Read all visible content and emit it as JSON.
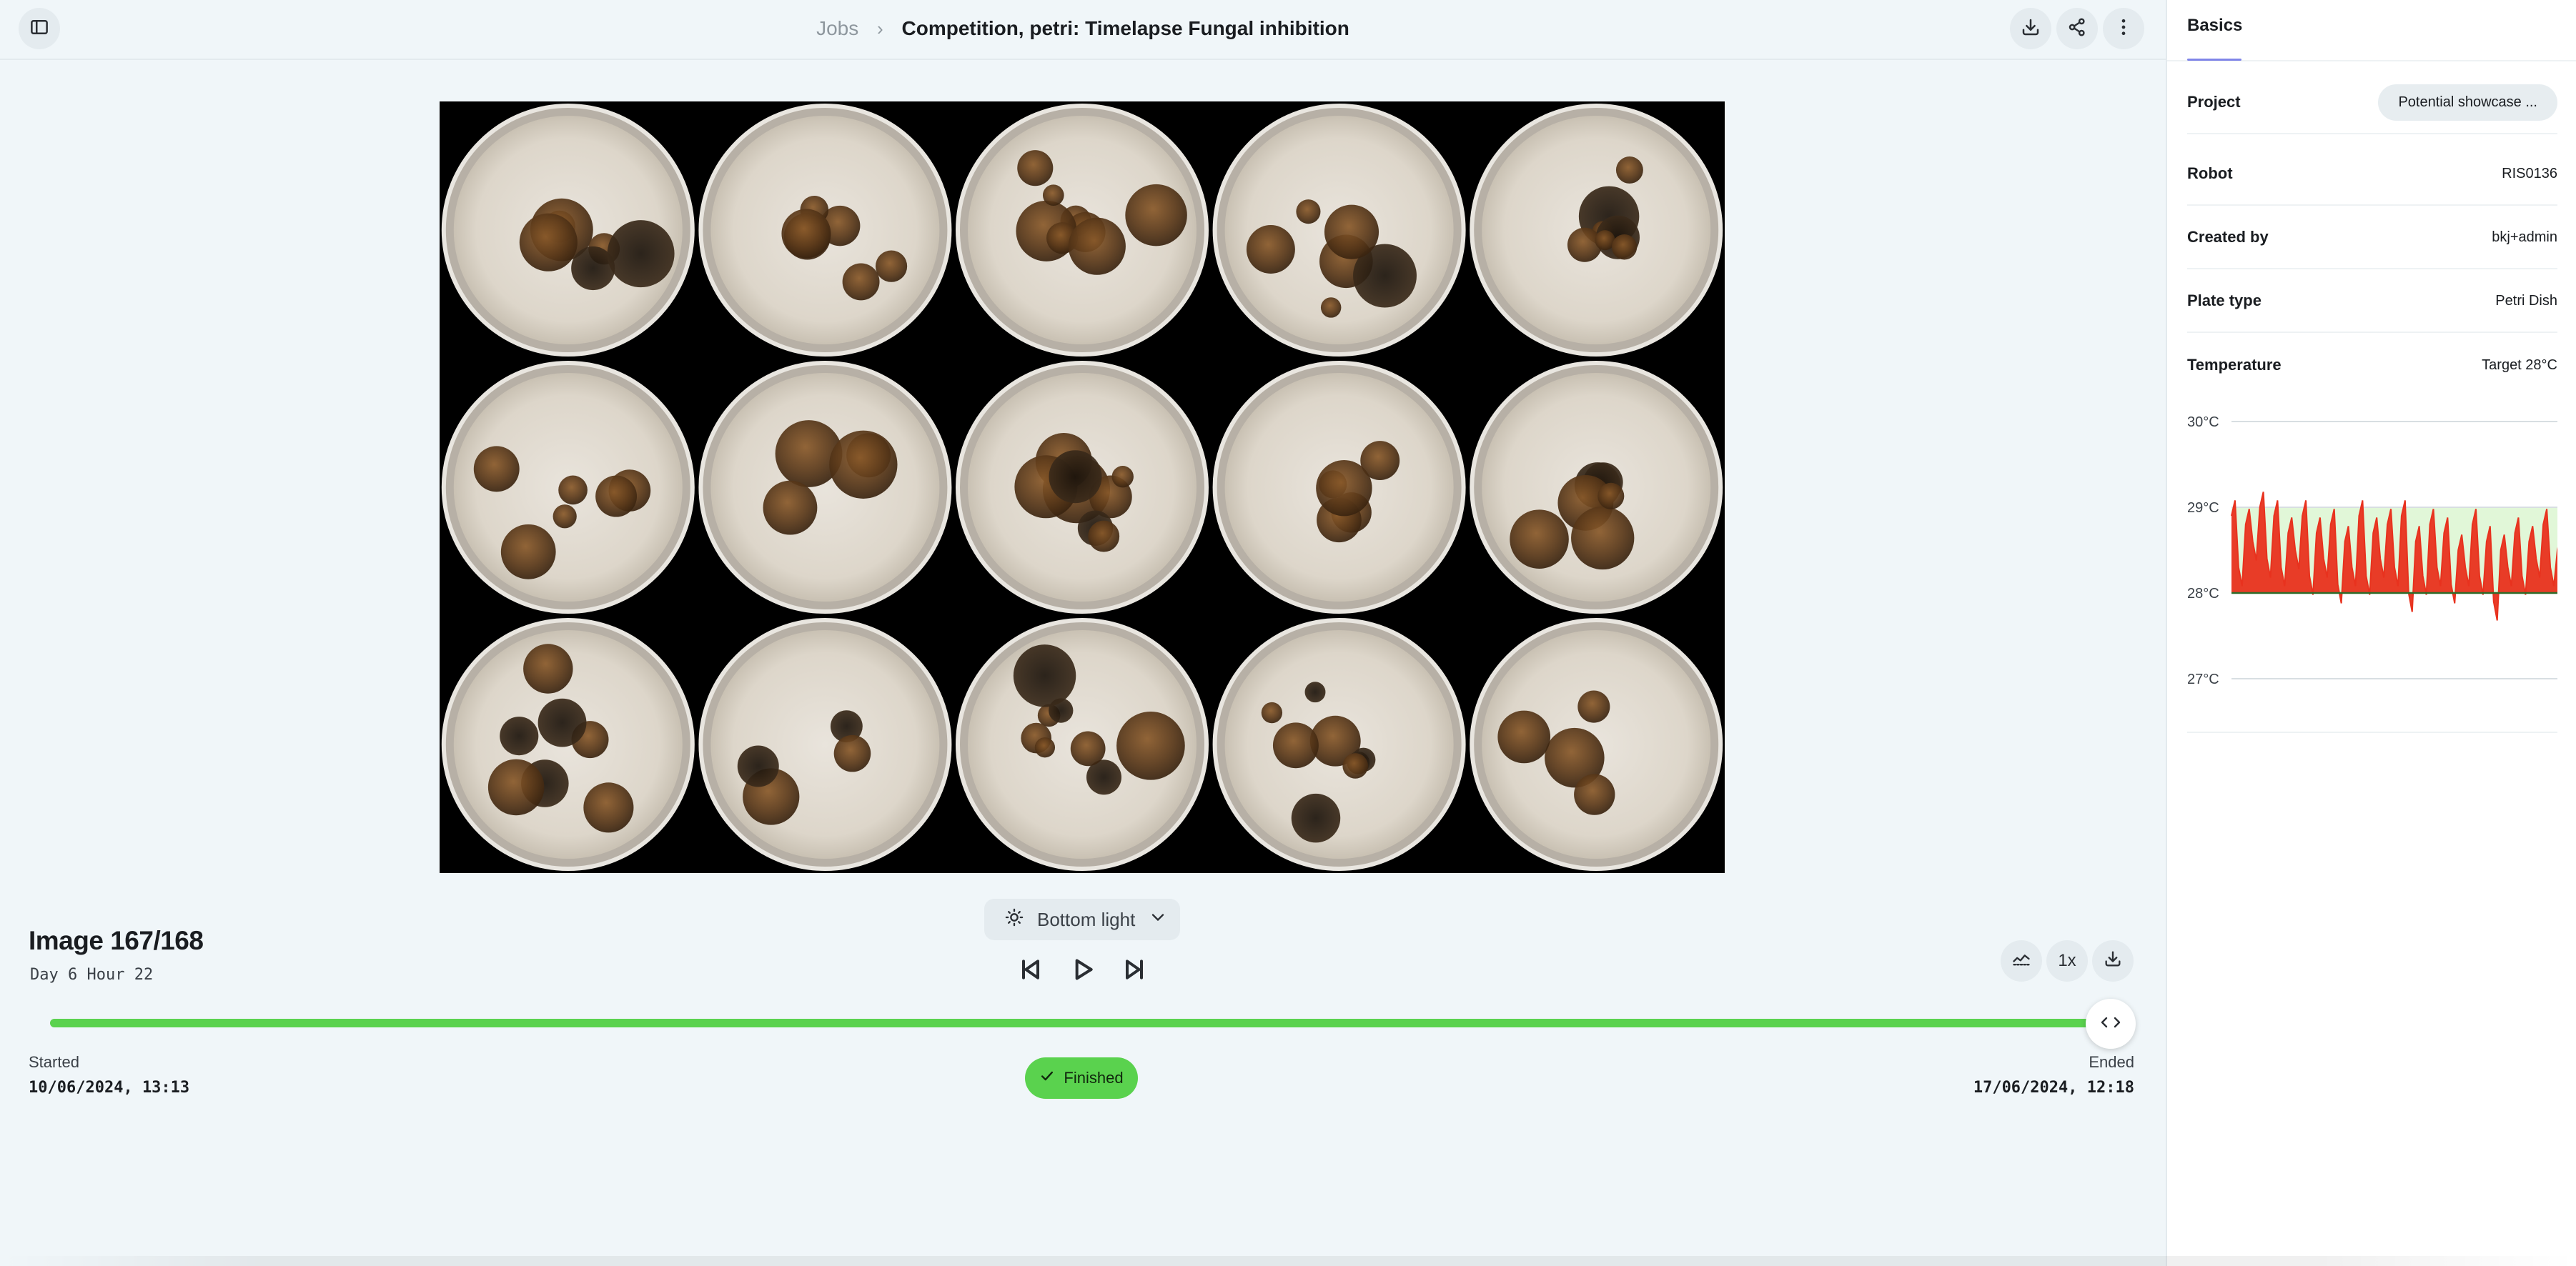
{
  "header": {
    "breadcrumb_root": "Jobs",
    "breadcrumb_separator": "›",
    "title": "Competition, petri: Timelapse Fungal inhibition",
    "icons": [
      "sidebar-toggle-icon",
      "download-icon",
      "share-icon",
      "more-vertical-icon"
    ]
  },
  "viewer": {
    "image_label": "Image 167/168",
    "timepoint": "Day 6 Hour 22",
    "light_mode": "Bottom light",
    "speed": "1x",
    "progress": 0.994,
    "status": "Finished",
    "started_label": "Started",
    "started_value": "10/06/2024, 13:13",
    "ended_label": "Ended",
    "ended_value": "17/06/2024, 12:18",
    "plate_grid": {
      "rows": 3,
      "cols": 5
    }
  },
  "sidepanel": {
    "tab": "Basics",
    "properties": [
      {
        "label": "Project",
        "value": "Potential showcase ..."
      },
      {
        "label": "Robot",
        "value": "RIS0136"
      },
      {
        "label": "Created by",
        "value": "bkj+admin"
      },
      {
        "label": "Plate type",
        "value": "Petri Dish"
      },
      {
        "label": "Temperature",
        "value": "Target 28°C"
      }
    ],
    "temperature_chart": {
      "y_ticks": [
        "30°C",
        "29°C",
        "28°C",
        "27°C"
      ],
      "ylim": [
        27,
        30
      ],
      "target": 28,
      "band": [
        28,
        29
      ],
      "colors": {
        "line": "#e8321e",
        "band": "#e1f7d8",
        "target": "#2f6b2a"
      }
    }
  },
  "chart_data": {
    "type": "line",
    "title": "",
    "xlabel": "",
    "ylabel": "",
    "ylim": [
      27,
      30
    ],
    "y_tick_labels": [
      "27°C",
      "28°C",
      "29°C",
      "30°C"
    ],
    "series": [
      {
        "values": [
          28.9,
          28.3,
          28.8,
          28.6,
          29.0,
          28.4,
          28.9,
          28.3,
          28.7,
          28.5,
          28.9,
          28.2,
          28.7,
          28.4,
          28.8,
          28.1,
          28.6,
          28.3,
          28.9,
          28.2,
          28.7,
          28.4,
          28.8,
          28.3,
          28.9,
          28.0,
          28.6,
          28.2,
          28.8,
          28.3,
          28.7,
          28.1,
          28.5,
          28.3,
          28.8,
          28.2,
          28.6,
          27.9,
          28.5,
          28.3,
          28.7,
          28.2,
          28.6,
          28.4,
          28.8,
          28.3,
          28.5
        ]
      }
    ]
  }
}
